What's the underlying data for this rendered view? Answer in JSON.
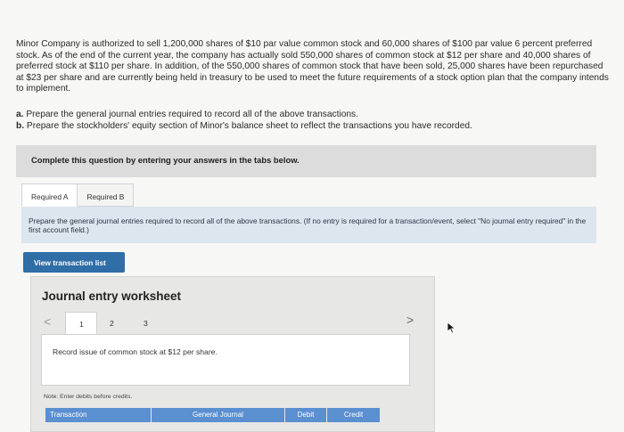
{
  "problem": {
    "text": "Minor Company is authorized to sell 1,200,000 shares of $10 par value common stock and 60,000 shares of $100 par value 6 percent preferred stock. As of the end of the current year, the company has actually sold 550,000 shares of common stock at $12 per share and 40,000 shares of preferred stock at $110 per share. In addition, of the 550,000 shares of common stock that have been sold, 25,000 shares have been repurchased at $23 per share and are currently being held in treasury to be used to meet the future requirements of a stock option plan that the company intends to implement.",
    "part_a_label": "a.",
    "part_a_text": "Prepare the general journal entries required to record all of the above transactions.",
    "part_b_label": "b.",
    "part_b_text": "Prepare the stockholders' equity section of Minor's balance sheet to reflect the transactions you have recorded."
  },
  "banner": {
    "text": "Complete this question by entering your answers in the tabs below."
  },
  "tabs": [
    {
      "label": "Required A",
      "active": true
    },
    {
      "label": "Required B",
      "active": false
    }
  ],
  "instructions": {
    "text": "Prepare the general journal entries required to record all of the above transactions. (If no entry is required for a transaction/event, select \"No journal entry required\" in the first account field.)"
  },
  "view_button": {
    "label": "View transaction list"
  },
  "worksheet": {
    "title": "Journal entry worksheet",
    "prev_icon": "<",
    "next_icon": ">",
    "pages": [
      "1",
      "2",
      "3"
    ],
    "active_page": "1",
    "entry_text": "Record issue of common stock at $12 per share.",
    "note": "Note: Enter debits before credits.",
    "columns": [
      "Transaction",
      "General Journal",
      "Debit",
      "Credit"
    ]
  },
  "colors": {
    "accent_button": "#2f6ea6",
    "table_header": "#5a8fd0",
    "instructions_bg": "#dde5ee"
  }
}
